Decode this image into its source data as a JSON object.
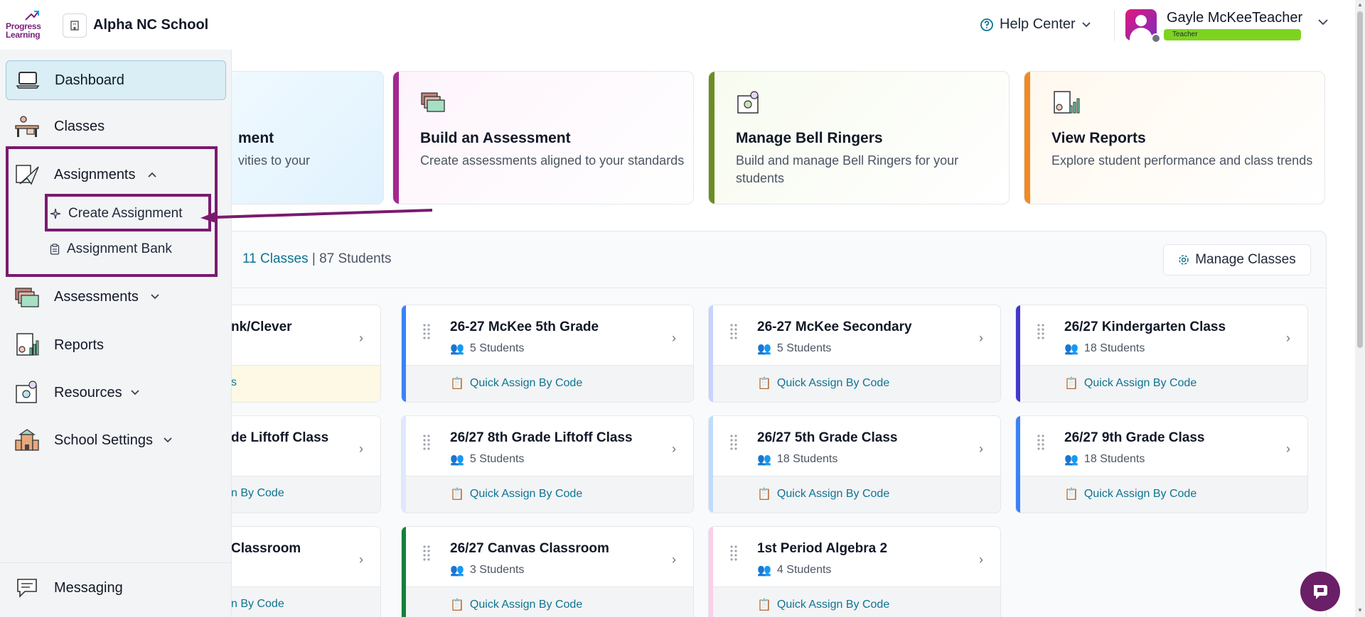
{
  "header": {
    "logo_line1": "Progress",
    "logo_line2": "Learning",
    "school_name": "Alpha NC School",
    "help_label": "Help Center",
    "user_name": "Gayle McKeeTeacher",
    "user_role": "Teacher"
  },
  "sidebar": {
    "items": [
      {
        "label": "Dashboard",
        "icon": "laptop-icon"
      },
      {
        "label": "Classes",
        "icon": "desk-icon"
      },
      {
        "label": "Assignments",
        "icon": "paper-plane-icon"
      },
      {
        "label": "Assessments",
        "icon": "folders-icon"
      },
      {
        "label": "Reports",
        "icon": "report-icon"
      },
      {
        "label": "Resources",
        "icon": "resources-icon"
      },
      {
        "label": "School Settings",
        "icon": "school-icon"
      },
      {
        "label": "Messaging",
        "icon": "chat-icon"
      }
    ],
    "assignments_sub": [
      {
        "label": "Create Assignment",
        "icon": "sparkle-icon"
      },
      {
        "label": "Assignment Bank",
        "icon": "clipboard-icon"
      }
    ]
  },
  "quick_cards": [
    {
      "title": "ment",
      "desc": "vities to your",
      "accent": "#38bdf8"
    },
    {
      "title": "Build an Assessment",
      "desc": "Create assessments aligned to your standards",
      "accent": "#a3288f"
    },
    {
      "title": "Manage Bell Ringers",
      "desc": "Build and manage Bell Ringers for your students",
      "accent": "#6b8e23"
    },
    {
      "title": "View Reports",
      "desc": "Explore student performance and class trends",
      "accent": "#f08a24"
    }
  ],
  "classes": {
    "count_link": "11 Classes",
    "separator": "|",
    "students": "87 Students",
    "manage_label": "Manage Classes",
    "quick_assign_label": "Quick Assign By Code",
    "cards": [
      {
        "name": "nk/Clever",
        "students": "",
        "foot": "s",
        "color": "#e5e7eb"
      },
      {
        "name": "26-27 McKee 5th Grade",
        "students": "5 Students",
        "color": "#3b82f6"
      },
      {
        "name": "26-27 McKee Secondary",
        "students": "5 Students",
        "color": "#c7d2fe"
      },
      {
        "name": "26/27 Kindergarten Class",
        "students": "18 Students",
        "color": "#4338ca"
      },
      {
        "name": "de Liftoff Class",
        "students": "",
        "foot": "n By Code",
        "color": "#e5e7eb"
      },
      {
        "name": "26/27 8th Grade Liftoff Class",
        "students": "5 Students",
        "color": "#e0e7ff"
      },
      {
        "name": "26/27 5th Grade Class",
        "students": "18 Students",
        "color": "#bfdbfe"
      },
      {
        "name": "26/27 9th Grade Class",
        "students": "18 Students",
        "color": "#3b82f6"
      },
      {
        "name": "Classroom",
        "students": "",
        "foot": "n By Code",
        "color": "#e5e7eb"
      },
      {
        "name": "26/27 Canvas Classroom",
        "students": "3 Students",
        "color": "#15803d"
      },
      {
        "name": "1st Period Algebra 2",
        "students": "4 Students",
        "color": "#fbcfe8"
      }
    ]
  }
}
